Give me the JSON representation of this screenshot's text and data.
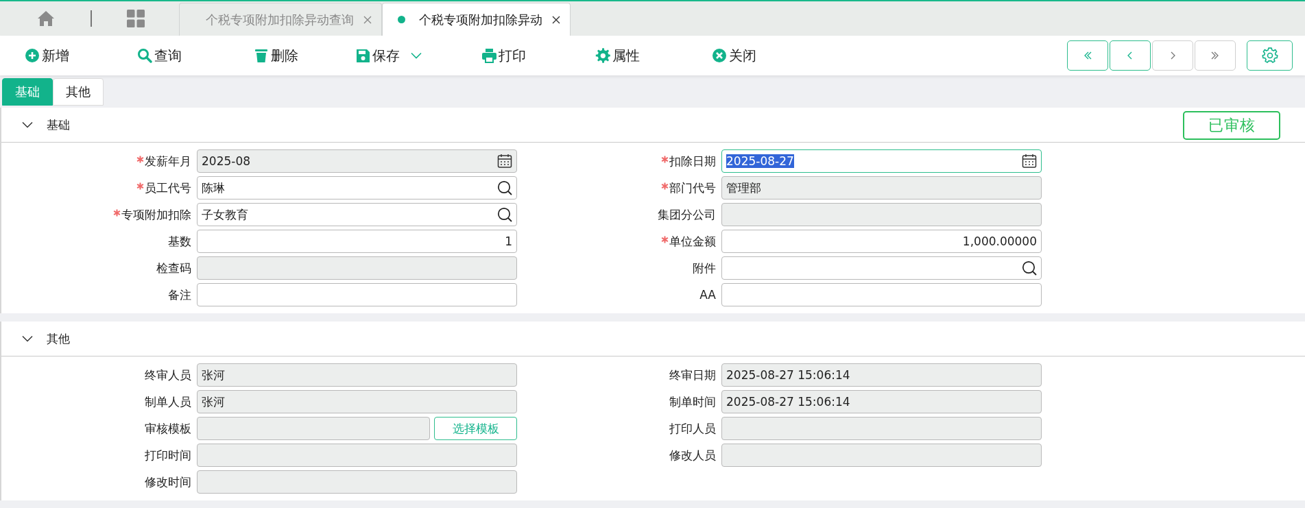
{
  "app_tabs": [
    {
      "label": "个税专项附加扣除异动查询",
      "selected": false
    },
    {
      "label": "个税专项附加扣除异动",
      "selected": true
    }
  ],
  "toolbar": [
    {
      "label": "新增",
      "kind": "add",
      "dropdown": false
    },
    {
      "label": "查询",
      "kind": "search",
      "dropdown": false
    },
    {
      "label": "删除",
      "kind": "delete",
      "dropdown": false
    },
    {
      "label": "保存",
      "kind": "save",
      "dropdown": true
    },
    {
      "label": "打印",
      "kind": "print",
      "dropdown": false
    },
    {
      "label": "属性",
      "kind": "settings",
      "dropdown": false
    },
    {
      "label": "关闭",
      "kind": "close",
      "dropdown": false
    }
  ],
  "record_nav": [
    {
      "kind": "first",
      "disabled": false
    },
    {
      "kind": "prev",
      "disabled": false
    },
    {
      "kind": "next",
      "disabled": true
    },
    {
      "kind": "last",
      "disabled": true
    }
  ],
  "form_tabs": [
    {
      "label": "基础",
      "selected": true
    },
    {
      "label": "其他",
      "selected": false
    }
  ],
  "sections": [
    {
      "title": "基础",
      "expanded": true,
      "status": "已审核",
      "rows": [
        [
          {
            "label": "发薪年月",
            "required": true,
            "value": "2025-08",
            "kind": "date",
            "readonly": true,
            "focused": false
          },
          {
            "label": "扣除日期",
            "required": true,
            "value": "2025-08-27",
            "kind": "date",
            "readonly": false,
            "focused": true
          }
        ],
        [
          {
            "label": "员工代号",
            "required": true,
            "value": "陈琳",
            "kind": "lookup",
            "readonly": false,
            "focused": false
          },
          {
            "label": "部门代号",
            "required": true,
            "value": "管理部",
            "kind": "text",
            "readonly": true,
            "focused": false
          }
        ],
        [
          {
            "label": "专项附加扣除",
            "required": true,
            "value": "子女教育",
            "kind": "lookup",
            "readonly": false,
            "focused": false
          },
          {
            "label": "集团分公司",
            "required": false,
            "kind": "text",
            "readonly": true,
            "focused": false
          }
        ],
        [
          {
            "label": "基数",
            "required": false,
            "value": "1",
            "kind": "number",
            "readonly": false,
            "focused": false
          },
          {
            "label": "单位金额",
            "required": true,
            "value": "1,000.00000",
            "kind": "number",
            "readonly": false,
            "focused": false
          }
        ],
        [
          {
            "label": "检查码",
            "required": false,
            "kind": "text",
            "readonly": true,
            "focused": false
          },
          {
            "label": "附件",
            "required": false,
            "kind": "lookup",
            "readonly": false,
            "focused": false
          }
        ],
        [
          {
            "label": "备注",
            "required": false,
            "kind": "text",
            "readonly": false,
            "focused": false
          },
          {
            "label": "AA",
            "required": false,
            "kind": "text",
            "readonly": false,
            "focused": false
          }
        ]
      ]
    },
    {
      "title": "其他",
      "expanded": true,
      "rows": [
        [
          {
            "label": "终审人员",
            "required": false,
            "value": "张河",
            "kind": "text",
            "readonly": true,
            "focused": false
          },
          {
            "label": "终审日期",
            "required": false,
            "value": "2025-08-27 15:06:14",
            "kind": "text",
            "readonly": true,
            "focused": false
          }
        ],
        [
          {
            "label": "制单人员",
            "required": false,
            "value": "张河",
            "kind": "text",
            "readonly": true,
            "focused": false
          },
          {
            "label": "制单时间",
            "required": false,
            "value": "2025-08-27 15:06:14",
            "kind": "text",
            "readonly": true,
            "focused": false
          }
        ],
        [
          {
            "label": "审核模板",
            "required": false,
            "kind": "text",
            "readonly": true,
            "focused": false,
            "button": "选择模板"
          },
          {
            "label": "打印人员",
            "required": false,
            "kind": "text",
            "readonly": true,
            "focused": false
          }
        ],
        [
          {
            "label": "打印时间",
            "required": false,
            "kind": "text",
            "readonly": true,
            "focused": false
          },
          {
            "label": "修改人员",
            "required": false,
            "kind": "text",
            "readonly": true,
            "focused": false
          }
        ],
        [
          {
            "label": "修改时间",
            "required": false,
            "kind": "text",
            "readonly": true,
            "focused": false
          }
        ]
      ]
    }
  ]
}
